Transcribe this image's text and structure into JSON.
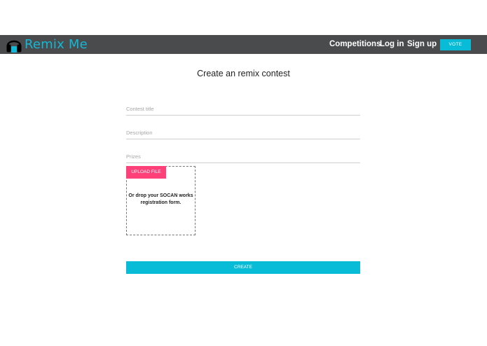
{
  "header": {
    "brand": "Remix Me",
    "nav": {
      "competitions": "Competitions",
      "login": "Log in",
      "signup": "Sign up",
      "vote": "VOTE"
    }
  },
  "form": {
    "title": "Create an remix contest",
    "fields": {
      "contest_title": "Contest title",
      "description": "Description",
      "prizes": "Prizes"
    },
    "upload": {
      "button": "UPLOAD FILE",
      "drop_text": "Or drop your SOCAN works registration form."
    },
    "submit": "CREATE"
  },
  "colors": {
    "navbar": "#4a4b4d",
    "accent": "#08bcd8",
    "upload": "#ff4079"
  }
}
